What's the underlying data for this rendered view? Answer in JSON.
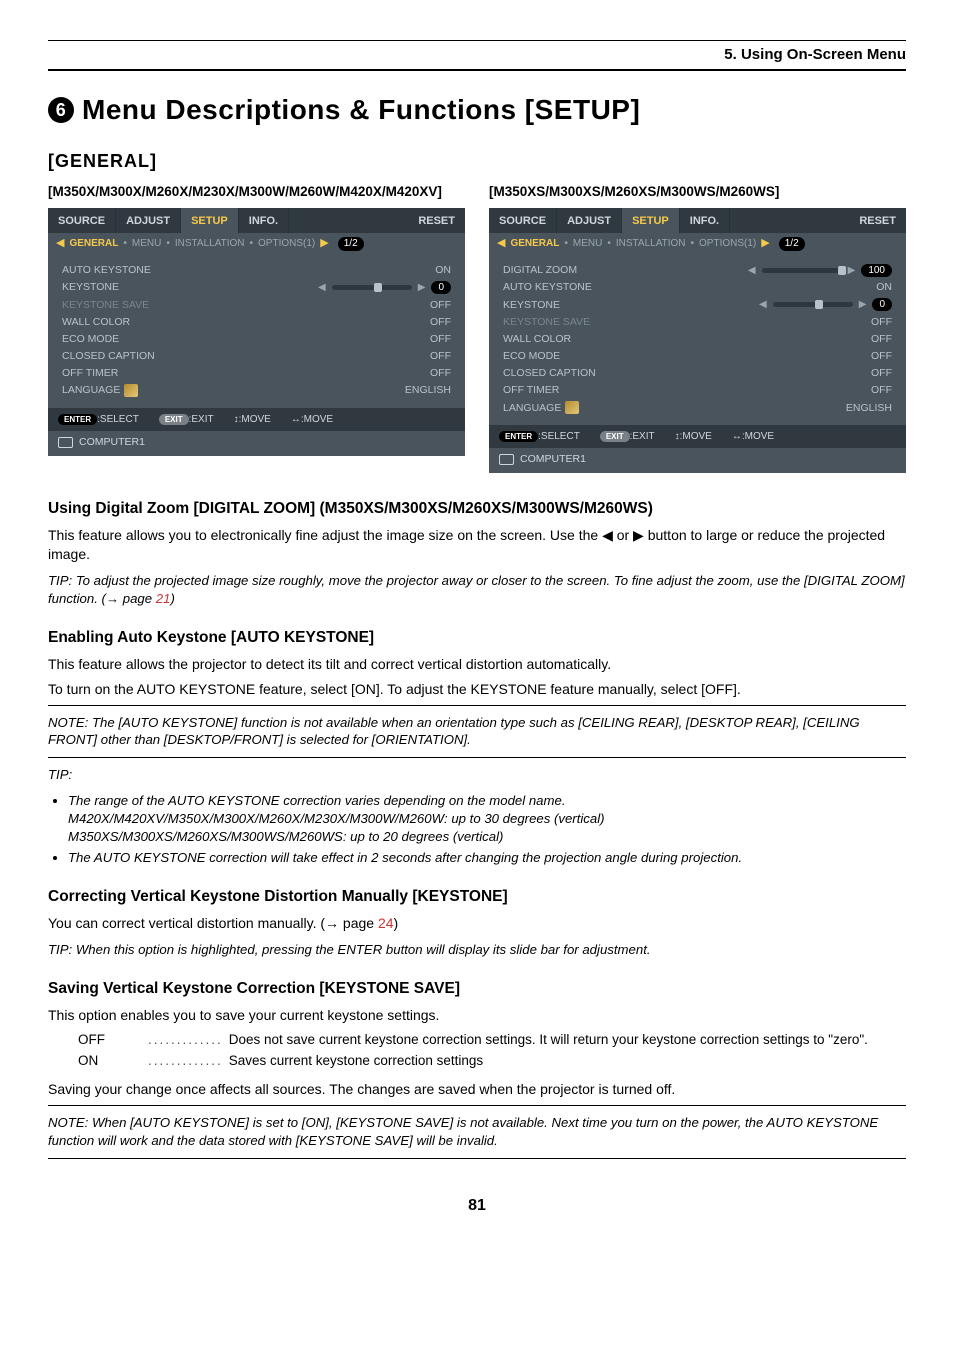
{
  "chapter": "5. Using On-Screen Menu",
  "circle_num": "6",
  "main_heading": "Menu Descriptions & Functions [SETUP]",
  "general_heading": "[GENERAL]",
  "left_panel_title": "[M350X/M300X/M260X/M230X/M300W/M260W/M420X/M420XV]",
  "right_panel_title": "[M350XS/M300XS/M260XS/M300WS/M260WS]",
  "osd": {
    "tabs": [
      "SOURCE",
      "ADJUST",
      "SETUP",
      "INFO.",
      "RESET"
    ],
    "active_tab": "SETUP",
    "subtabs": {
      "arrow_l": "◀",
      "active": "GENERAL",
      "items": [
        "MENU",
        "INSTALLATION",
        "OPTIONS(1)"
      ],
      "arrow_r": "▶",
      "page": "1/2"
    },
    "footer": {
      "enter": "ENTER",
      "select": ":SELECT",
      "exit": "EXIT",
      "exit_t": ":EXIT",
      "move_v": "↕:MOVE",
      "move_h": "↔:MOVE"
    },
    "source_row": "COMPUTER1"
  },
  "left_rows": [
    {
      "label": "AUTO KEYSTONE",
      "val": "ON",
      "dim": false,
      "slider": false
    },
    {
      "label": "KEYSTONE",
      "val": "0",
      "dim": false,
      "slider": true,
      "thumb": 42
    },
    {
      "label": "KEYSTONE SAVE",
      "val": "OFF",
      "dim": true,
      "slider": false
    },
    {
      "label": "WALL COLOR",
      "val": "OFF",
      "dim": false,
      "slider": false
    },
    {
      "label": "ECO MODE",
      "val": "OFF",
      "dim": false,
      "slider": false
    },
    {
      "label": "CLOSED CAPTION",
      "val": "OFF",
      "dim": false,
      "slider": false
    },
    {
      "label": "OFF TIMER",
      "val": "OFF",
      "dim": false,
      "slider": false
    },
    {
      "label": "LANGUAGE",
      "val": "ENGLISH",
      "dim": false,
      "slider": false,
      "lang": true
    }
  ],
  "right_rows": [
    {
      "label": "DIGITAL ZOOM",
      "val": "100",
      "dim": false,
      "slider": true,
      "thumb": 76
    },
    {
      "label": "AUTO KEYSTONE",
      "val": "ON",
      "dim": false,
      "slider": false
    },
    {
      "label": "KEYSTONE",
      "val": "0",
      "dim": false,
      "slider": true,
      "thumb": 42
    },
    {
      "label": "KEYSTONE SAVE",
      "val": "OFF",
      "dim": true,
      "slider": false
    },
    {
      "label": "WALL COLOR",
      "val": "OFF",
      "dim": false,
      "slider": false
    },
    {
      "label": "ECO MODE",
      "val": "OFF",
      "dim": false,
      "slider": false
    },
    {
      "label": "CLOSED CAPTION",
      "val": "OFF",
      "dim": false,
      "slider": false
    },
    {
      "label": "OFF TIMER",
      "val": "OFF",
      "dim": false,
      "slider": false
    },
    {
      "label": "LANGUAGE",
      "val": "ENGLISH",
      "dim": false,
      "slider": false,
      "lang": true
    }
  ],
  "s1": {
    "h": "Using Digital Zoom [DIGITAL ZOOM] (M350XS/M300XS/M260XS/M300WS/M260WS)",
    "p": "This feature allows you to electronically fine adjust the image size on the screen. Use the ◀ or ▶ button to large or reduce the projected image.",
    "tip_a": "TIP: To adjust the projected image size roughly, move the projector away or closer to the screen. To fine adjust the zoom, use the [DIGITAL ZOOM] function. (→ page ",
    "tip_link": "21",
    "tip_b": ")"
  },
  "s2": {
    "h": "Enabling Auto Keystone [AUTO KEYSTONE]",
    "p1": "This feature allows the projector to detect its tilt and correct vertical distortion automatically.",
    "p2": "To turn on the AUTO KEYSTONE feature, select [ON]. To adjust the KEYSTONE feature manually, select [OFF].",
    "note": "NOTE: The [AUTO KEYSTONE] function is not available when an orientation type such as [CEILING REAR], [DESKTOP REAR], [CEILING FRONT] other than [DESKTOP/FRONT] is selected for [ORIENTATION].",
    "tip_lead": "TIP:",
    "b1a": "The range of the AUTO KEYSTONE correction varies depending on the model name.",
    "b1b": "M420X/M420XV/M350X/M300X/M260X/M230X/M300W/M260W: up to 30 degrees (vertical)",
    "b1c": "M350XS/M300XS/M260XS/M300WS/M260WS: up to 20 degrees (vertical)",
    "b2": "The AUTO KEYSTONE correction will take effect in 2 seconds after changing the projection angle during projection."
  },
  "s3": {
    "h": "Correcting Vertical Keystone Distortion Manually [KEYSTONE]",
    "p_a": "You can correct vertical distortion manually. (→ page ",
    "p_link": "24",
    "p_b": ")",
    "tip": "TIP: When this option is highlighted, pressing the ENTER button will display its slide bar for adjustment."
  },
  "s4": {
    "h": "Saving Vertical Keystone Correction [KEYSTONE SAVE]",
    "p": "This option enables you to save your current keystone settings.",
    "off_term": "OFF",
    "off_def": "Does not save current keystone correction settings. It will return your keystone correction settings to \"zero\".",
    "on_term": "ON",
    "on_def": "Saves current keystone correction settings",
    "p2": "Saving your change once affects all sources. The changes are saved when the projector is turned off.",
    "note": "NOTE: When [AUTO KEYSTONE] is set to [ON], [KEYSTONE SAVE] is not available. Next time you turn on the power, the AUTO KEYSTONE function will work and the data stored with [KEYSTONE SAVE] will be invalid."
  },
  "pagenum": "81"
}
